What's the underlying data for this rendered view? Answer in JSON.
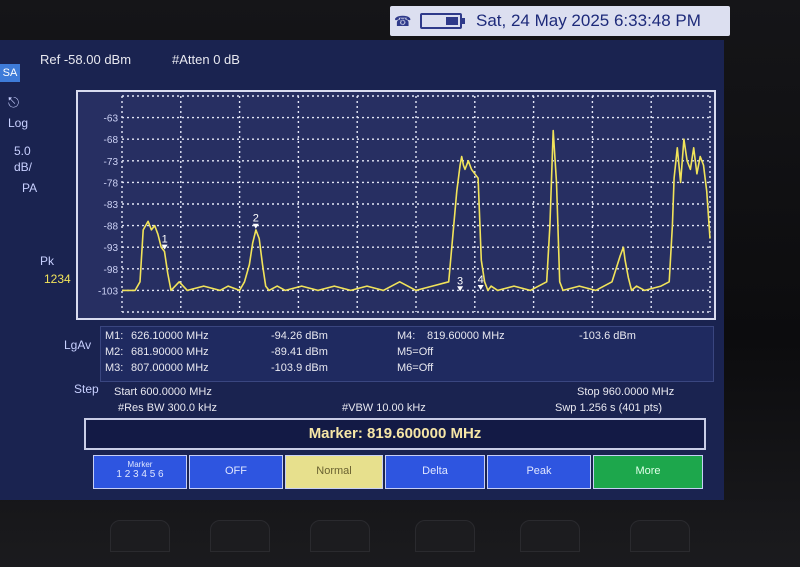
{
  "status_bar": {
    "datetime": "Sat, 24 May 2025 6:33:48 PM",
    "icons": [
      "signal-icon",
      "battery-icon"
    ]
  },
  "header": {
    "mode": "SA",
    "ref": "Ref -58.00 dBm",
    "atten": "#Atten 0 dB"
  },
  "left_panel": {
    "log": "Log",
    "scale_value": "5.0",
    "scale_unit": "dB/",
    "pa": "PA",
    "pk": "Pk",
    "marker_nums": "1234",
    "lgav": "LgAv",
    "step": "Step"
  },
  "chart_data": {
    "type": "line",
    "yticks": [
      -63,
      -68,
      -73,
      -78,
      -83,
      -88,
      -93,
      -98,
      -103
    ],
    "ylim": [
      -108,
      -58
    ],
    "xlim": [
      600,
      960
    ],
    "series": [
      {
        "x": [
          600,
          608,
          611,
          613,
          616,
          618,
          620,
          622,
          624,
          626,
          628,
          630,
          635,
          640,
          650,
          660,
          665,
          672,
          675,
          678,
          680,
          682,
          684,
          686,
          688,
          690,
          695,
          700,
          710,
          720,
          730,
          740,
          750,
          760,
          770,
          780,
          790,
          800,
          805,
          807,
          808,
          809,
          810,
          812,
          814,
          816,
          818,
          820,
          822,
          824,
          826,
          830,
          840,
          850,
          860,
          862,
          864,
          866,
          868,
          870,
          880,
          890,
          900,
          905,
          907,
          908,
          910,
          912,
          915,
          920,
          930,
          935,
          937,
          938,
          940,
          942,
          944,
          946,
          948,
          950,
          952,
          954,
          956,
          958,
          960
        ],
        "y": [
          -103,
          -103,
          -101,
          -89,
          -87,
          -89,
          -88,
          -90,
          -93,
          -94,
          -99,
          -103,
          -101,
          -103,
          -102,
          -103,
          -102,
          -103,
          -101,
          -97,
          -92,
          -89,
          -91,
          -97,
          -102,
          -103,
          -102,
          -103,
          -102,
          -103,
          -102,
          -103,
          -102,
          -103,
          -101,
          -103,
          -102,
          -101,
          -80,
          -74,
          -72,
          -74,
          -75,
          -73,
          -75,
          -76,
          -77,
          -96,
          -101,
          -103,
          -102,
          -103,
          -102,
          -103,
          -101,
          -88,
          -66,
          -78,
          -101,
          -103,
          -102,
          -103,
          -101,
          -95,
          -93,
          -96,
          -100,
          -103,
          -102,
          -103,
          -102,
          -101,
          -88,
          -77,
          -70,
          -78,
          -68,
          -73,
          -75,
          -70,
          -76,
          -72,
          -74,
          -80,
          -91
        ]
      }
    ],
    "markers": [
      {
        "label": "1",
        "x": 626.1,
        "y": -94.26
      },
      {
        "label": "2",
        "x": 681.9,
        "y": -89.41
      },
      {
        "label": "3",
        "x": 807.0,
        "y": -103.9
      },
      {
        "label": "4",
        "x": 819.6,
        "y": -103.6
      }
    ],
    "grid": true,
    "trace_color": "#f1e35a",
    "grid_color": "#e4e7f7",
    "background": "#272f62"
  },
  "marker_table": {
    "rows": [
      {
        "name": "M1:",
        "freq": "626.10000 MHz",
        "level": "-94.26 dBm"
      },
      {
        "name": "M2:",
        "freq": "681.90000 MHz",
        "level": "-89.41 dBm"
      },
      {
        "name": "M3:",
        "freq": "807.00000 MHz",
        "level": "-103.9 dBm"
      }
    ],
    "m4_name": "M4:",
    "m4_freq": "819.60000 MHz",
    "m4_level": "-103.6 dBm",
    "m5": "M5=Off",
    "m6": "M6=Off"
  },
  "sweep_info": {
    "start": "Start 600.0000 MHz",
    "stop": "Stop 960.0000 MHz",
    "rbw": "#Res BW 300.0 kHz",
    "vbw": "#VBW 10.00 kHz",
    "swp": "Swp 1.256  s (401 pts)"
  },
  "marker_readout": "Marker: 819.600000 MHz",
  "softkeys": [
    {
      "label": "Marker",
      "sub": "1 2 3 4 5 6",
      "state": "normal"
    },
    {
      "label": "OFF",
      "state": "normal"
    },
    {
      "label": "Normal",
      "state": "selected"
    },
    {
      "label": "Delta",
      "state": "normal"
    },
    {
      "label": "Peak",
      "state": "normal"
    },
    {
      "label": "More",
      "state": "more"
    }
  ]
}
